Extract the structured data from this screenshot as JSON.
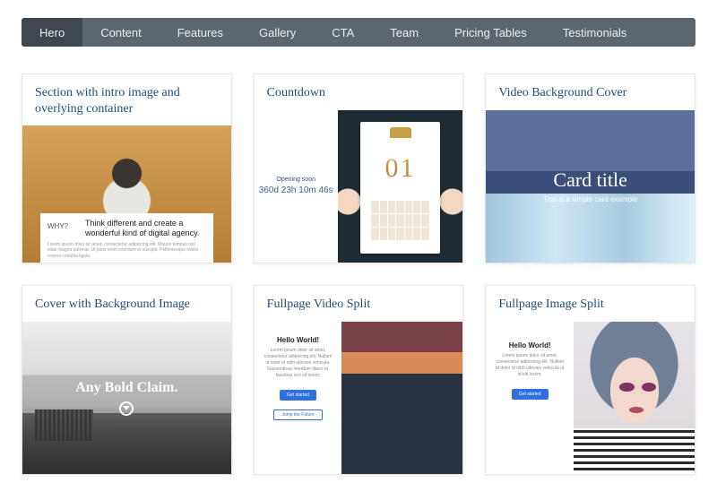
{
  "tabs": [
    "Hero",
    "Content",
    "Features",
    "Gallery",
    "CTA",
    "Team",
    "Pricing Tables",
    "Testimonials"
  ],
  "active_tab": 0,
  "cards": [
    {
      "title": "Section with intro image and overlying container",
      "why": "WHY?",
      "lead": "Think different and create a wonderful kind of digital agency.",
      "lorem": "Lorem ipsum dolor sit amet, consectetur adipiscing elit. Mauris tempus nisl vitae magna pulvinar. Ut justo enim interdum et suscipit. Pellentesque mollis viverra conubia ligula."
    },
    {
      "title": "Countdown",
      "opening": "Opening soon",
      "count": "360d 23h 10m 46s",
      "calendar_big": "01"
    },
    {
      "title": "Video Background Cover",
      "overlay_title": "Card title",
      "overlay_sub": "This is a simple card example"
    },
    {
      "title": "Cover with Background Image",
      "claim": "Any Bold Claim."
    },
    {
      "title": "Fullpage Video Split",
      "hello": "Hello World!",
      "lorem": "Lorem ipsum dolor sit amet, consectetur adipiscing elit. Nullam id dolor id nibh ultricies vehicula. Suspendisse interdum libero et, faucibus orci sit lorem.",
      "btn1": "Get started",
      "btn2": "Jump the Future"
    },
    {
      "title": "Fullpage Image Split",
      "hello": "Hello World!",
      "lorem": "Lorem ipsum dolor sit amet, consectetur adipiscing elit. Nullam id dolor id nibh ultricies vehicula ut id elit lorem.",
      "btn": "Get started"
    }
  ]
}
